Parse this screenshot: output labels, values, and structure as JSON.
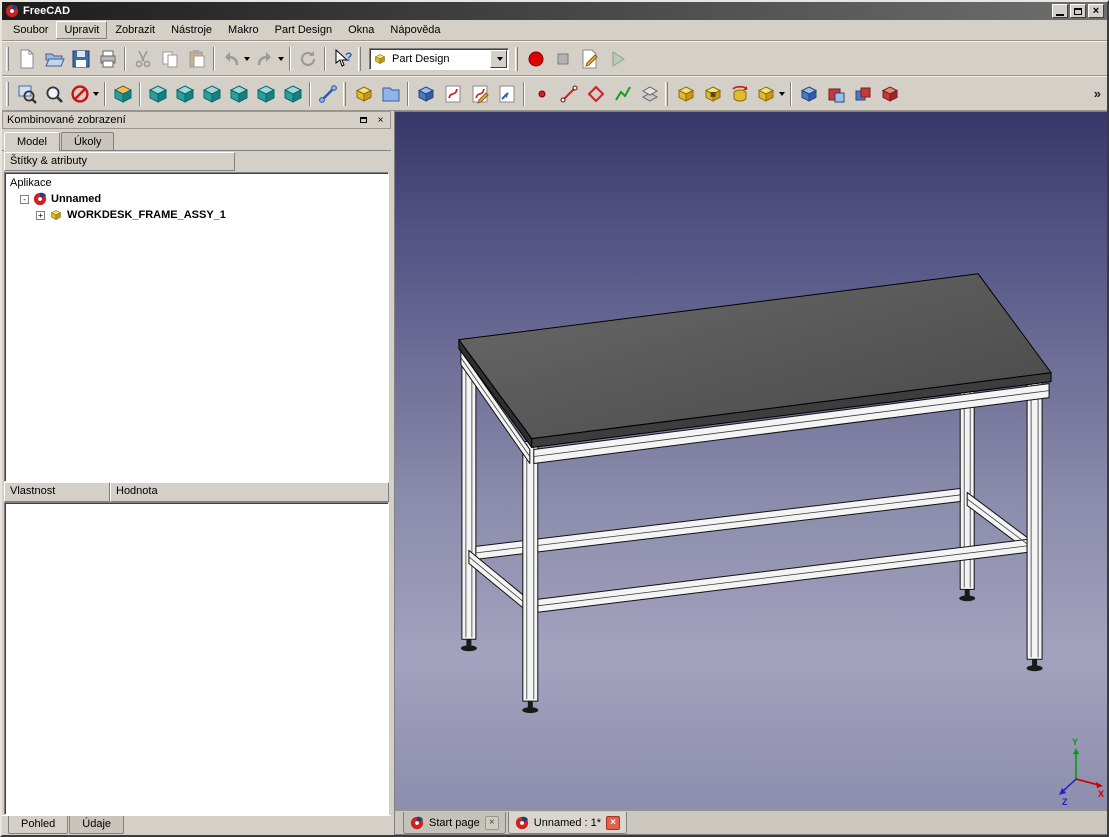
{
  "window": {
    "title": "FreeCAD"
  },
  "menubar": {
    "items": [
      "Soubor",
      "Upravit",
      "Zobrazit",
      "Nástroje",
      "Makro",
      "Part Design",
      "Okna",
      "Nápověda"
    ]
  },
  "toolbars": {
    "workbench_selector": "Part Design",
    "overflow": "»"
  },
  "icons": {
    "close": "×",
    "collapse": "-",
    "expand": "+"
  },
  "dock": {
    "title": "Kombinované zobrazení",
    "tabs": {
      "model": "Model",
      "tasks": "Úkoly"
    },
    "tree_header": "Štítky & atributy",
    "tree": {
      "root": "Aplikace",
      "document": "Unnamed",
      "part": "WORKDESK_FRAME_ASSY_1"
    },
    "properties": {
      "col_property": "Vlastnost",
      "col_value": "Hodnota"
    },
    "bottom_tabs": {
      "view": "Pohled",
      "data": "Údaje"
    }
  },
  "viewport": {
    "tabs": [
      {
        "label": "Start page"
      },
      {
        "label": "Unnamed : 1*"
      }
    ],
    "axis": {
      "x": "X",
      "y": "Y",
      "z": "Z"
    }
  }
}
